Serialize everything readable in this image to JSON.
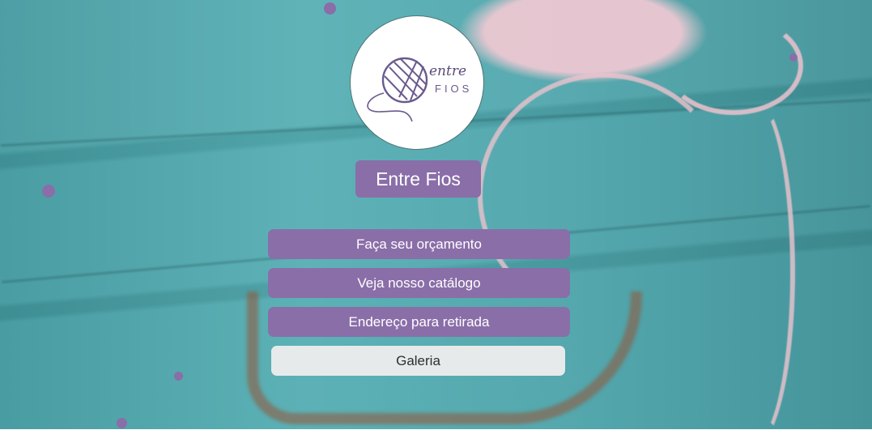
{
  "logo": {
    "word_top": "entre",
    "word_bottom": "FIOS"
  },
  "title": "Entre Fios",
  "links": [
    {
      "label": "Faça seu orçamento"
    },
    {
      "label": "Veja nosso catálogo"
    },
    {
      "label": "Endereço para retirada"
    },
    {
      "label": "Galeria"
    }
  ],
  "colors": {
    "accent": "#8a6ea8",
    "light_button": "#e7eaea",
    "background": "#4aa6ac"
  }
}
